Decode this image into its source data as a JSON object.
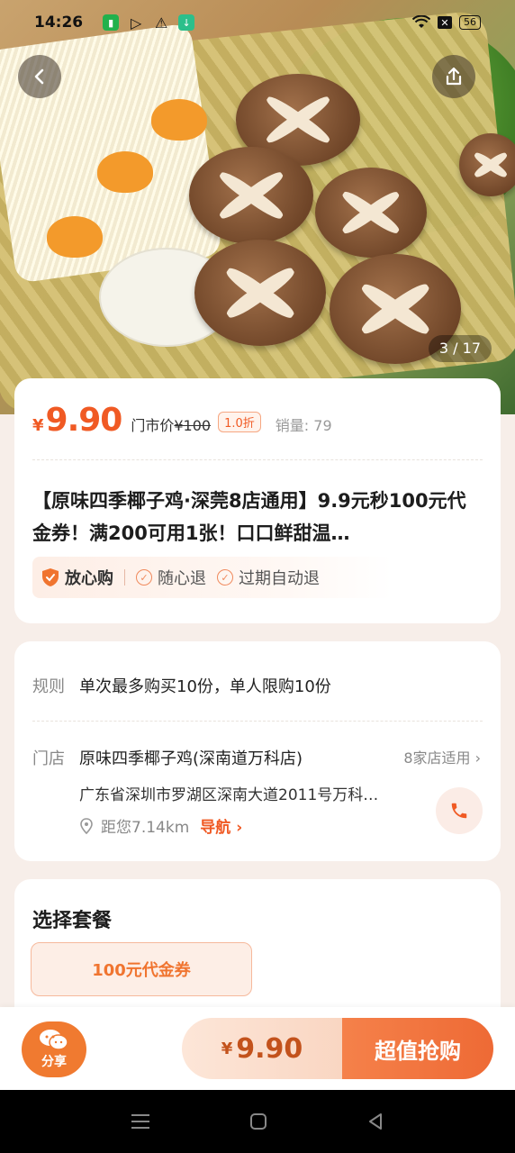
{
  "status_bar": {
    "time": "14:26",
    "battery": "56"
  },
  "gallery": {
    "counter": "3 / 17"
  },
  "price_card": {
    "currency": "¥",
    "price": "9.90",
    "original_label": "门市价",
    "original_price": "¥100",
    "discount": "1.0折",
    "sales": "销量: 79",
    "title": "【原味四季椰子鸡·深莞8店通用】9.9元秒100元代金券！满200可用1张！口口鲜甜温…",
    "guarantees": {
      "main": "放心购",
      "items": [
        "随心退",
        "过期自动退"
      ]
    }
  },
  "info_card": {
    "rule_label": "规则",
    "rule_text": "单次最多购买10份，单人限购10份",
    "store_label": "门店",
    "store_name": "原味四季椰子鸡(深南道万科店)",
    "stores_applicable": "8家店适用",
    "address": "广东省深圳市罗湖区深南大道2011号万科…",
    "distance": "距您7.14km",
    "navigate": "导航"
  },
  "package_card": {
    "title": "选择套餐",
    "option": "100元代金券"
  },
  "bottom_bar": {
    "share": "分享",
    "currency": "¥",
    "price": "9.90",
    "buy_label": "超值抢购"
  },
  "colors": {
    "accent": "#f05a24",
    "buy_button": "#ee6a35"
  }
}
